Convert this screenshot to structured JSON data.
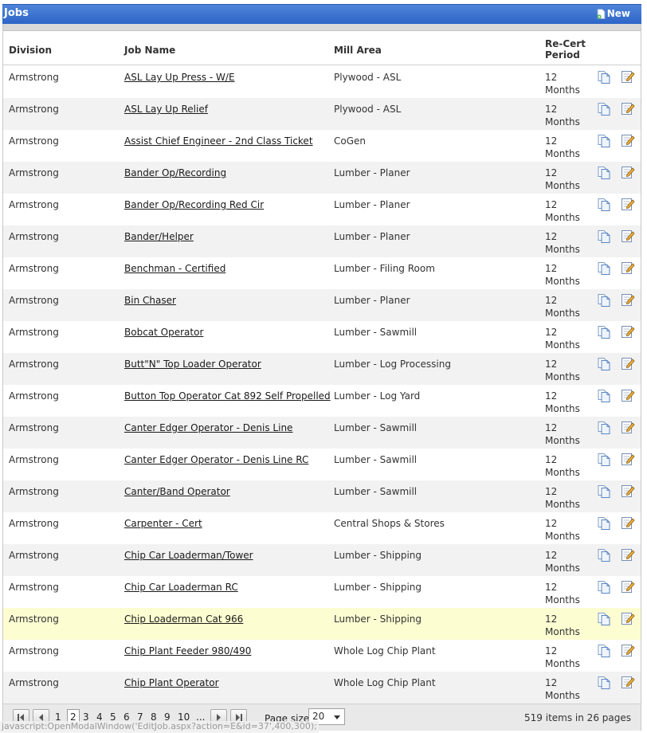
{
  "header": {
    "title": "Jobs",
    "new_label": "New"
  },
  "columns": {
    "division": "Division",
    "job_name": "Job Name",
    "mill_area": "Mill Area",
    "recert_line1": "Re-Cert",
    "recert_line2": "Period"
  },
  "rows": [
    {
      "division": "Armstrong",
      "job": "ASL Lay Up Press - W/E",
      "mill": "Plywood - ASL",
      "n": "12",
      "unit": "Months"
    },
    {
      "division": "Armstrong",
      "job": "ASL Lay Up Relief",
      "mill": "Plywood - ASL",
      "n": "12",
      "unit": "Months"
    },
    {
      "division": "Armstrong",
      "job": "Assist Chief Engineer - 2nd Class Ticket",
      "mill": "CoGen",
      "n": "12",
      "unit": "Months"
    },
    {
      "division": "Armstrong",
      "job": "Bander Op/Recording",
      "mill": "Lumber - Planer",
      "n": "12",
      "unit": "Months"
    },
    {
      "division": "Armstrong",
      "job": "Bander Op/Recording Red Cir",
      "mill": "Lumber - Planer",
      "n": "12",
      "unit": "Months"
    },
    {
      "division": "Armstrong",
      "job": "Bander/Helper",
      "mill": "Lumber - Planer",
      "n": "12",
      "unit": "Months"
    },
    {
      "division": "Armstrong",
      "job": "Benchman - Certified",
      "mill": "Lumber - Filing Room",
      "n": "12",
      "unit": "Months"
    },
    {
      "division": "Armstrong",
      "job": "Bin Chaser",
      "mill": "Lumber - Planer",
      "n": "12",
      "unit": "Months"
    },
    {
      "division": "Armstrong",
      "job": "Bobcat Operator",
      "mill": "Lumber - Sawmill",
      "n": "12",
      "unit": "Months"
    },
    {
      "division": "Armstrong",
      "job": "Butt\"N\" Top Loader Operator",
      "mill": "Lumber - Log Processing",
      "n": "12",
      "unit": "Months"
    },
    {
      "division": "Armstrong",
      "job": "Button Top Operator Cat 892 Self Propelled",
      "mill": "Lumber - Log Yard",
      "n": "12",
      "unit": "Months"
    },
    {
      "division": "Armstrong",
      "job": "Canter Edger Operator - Denis Line",
      "mill": "Lumber - Sawmill",
      "n": "12",
      "unit": "Months"
    },
    {
      "division": "Armstrong",
      "job": "Canter Edger Operator - Denis Line RC",
      "mill": "Lumber - Sawmill",
      "n": "12",
      "unit": "Months"
    },
    {
      "division": "Armstrong",
      "job": "Canter/Band Operator",
      "mill": "Lumber - Sawmill",
      "n": "12",
      "unit": "Months"
    },
    {
      "division": "Armstrong",
      "job": "Carpenter - Cert",
      "mill": "Central Shops & Stores",
      "n": "12",
      "unit": "Months"
    },
    {
      "division": "Armstrong",
      "job": "Chip Car Loaderman/Tower",
      "mill": "Lumber - Shipping",
      "n": "12",
      "unit": "Months"
    },
    {
      "division": "Armstrong",
      "job": "Chip Car Loaderman RC",
      "mill": "Lumber - Shipping",
      "n": "12",
      "unit": "Months"
    },
    {
      "division": "Armstrong",
      "job": "Chip Loaderman Cat 966",
      "mill": "Lumber - Shipping",
      "n": "12",
      "unit": "Months"
    },
    {
      "division": "Armstrong",
      "job": "Chip Plant Feeder 980/490",
      "mill": "Whole Log Chip Plant",
      "n": "12",
      "unit": "Months"
    },
    {
      "division": "Armstrong",
      "job": "Chip Plant Operator",
      "mill": "Whole Log Chip Plant",
      "n": "12",
      "unit": "Months"
    }
  ],
  "highlighted_row_index": 17,
  "pager": {
    "pages": [
      "1",
      "2",
      "3",
      "4",
      "5",
      "6",
      "7",
      "8",
      "9",
      "10",
      "..."
    ],
    "current_page": "2",
    "page_size_label": "Page size:",
    "page_size_value": "20",
    "items_text": "519 items in 26 pages"
  },
  "status_bar": "javascript:OpenModalWindow('EditJob.aspx?action=E&id=37',400,300);"
}
